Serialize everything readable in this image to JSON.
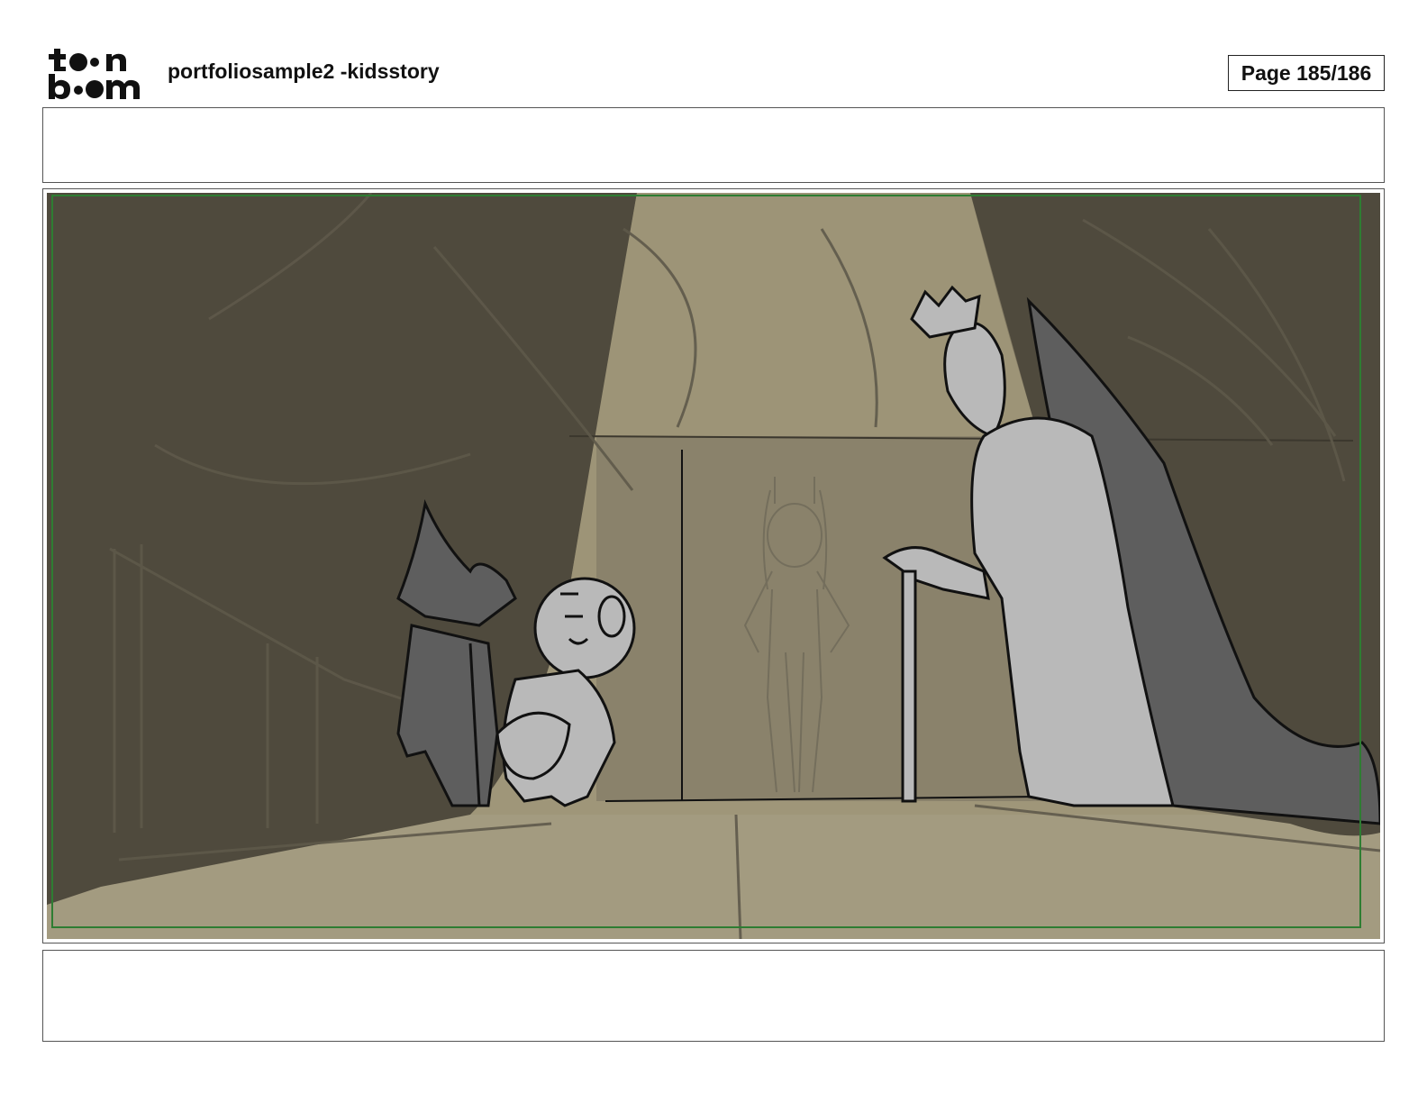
{
  "header": {
    "logo_text_top": "toon",
    "logo_text_bottom": "boom",
    "title": "portfoliosample2 -kidsstory",
    "page_label": "Page 185/186"
  },
  "panel": {
    "frame_color": "#2e7d32",
    "palette": {
      "shadow": "#4f4a3d",
      "light": "#9f9679",
      "floor": "#a39b80",
      "character_light": "#b9b9b9",
      "character_dark": "#5e5e5e",
      "line": "#111111"
    }
  },
  "top_caption": "",
  "bottom_caption": ""
}
